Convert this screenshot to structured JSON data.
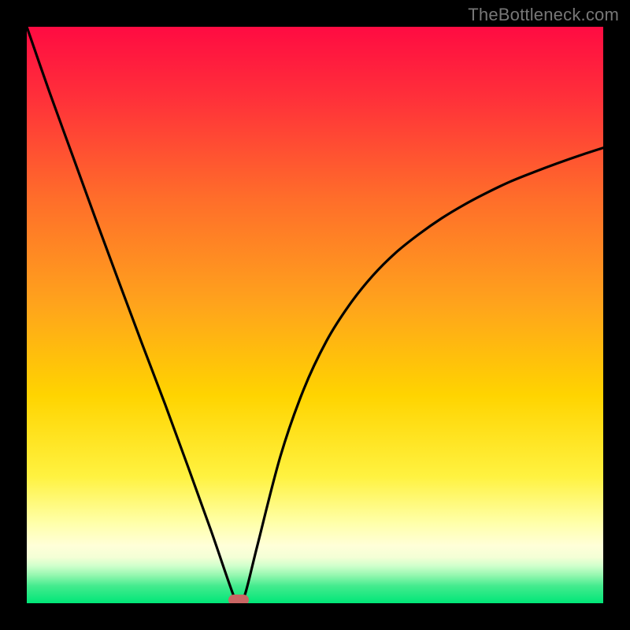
{
  "watermark": "TheBottleneck.com",
  "chart_data": {
    "type": "line",
    "title": "",
    "xlabel": "",
    "ylabel": "",
    "xlim": [
      0,
      1
    ],
    "ylim": [
      0,
      1
    ],
    "x": [
      0.0,
      0.04,
      0.08,
      0.12,
      0.16,
      0.2,
      0.24,
      0.28,
      0.32,
      0.36,
      0.37,
      0.38,
      0.4,
      0.44,
      0.48,
      0.52,
      0.56,
      0.6,
      0.64,
      0.68,
      0.72,
      0.76,
      0.8,
      0.84,
      0.88,
      0.92,
      0.96,
      1.0
    ],
    "values": [
      1.0,
      0.885,
      0.775,
      0.665,
      0.557,
      0.45,
      0.345,
      0.236,
      0.125,
      0.01,
      0.0,
      0.02,
      0.1,
      0.255,
      0.37,
      0.455,
      0.518,
      0.568,
      0.608,
      0.64,
      0.668,
      0.692,
      0.713,
      0.732,
      0.748,
      0.763,
      0.777,
      0.79
    ],
    "legend": {
      "entries": []
    },
    "grid": false,
    "marker_x": 0.368,
    "marker_y": 0.0,
    "annotations": [],
    "background_colors": {
      "top": "#ff0b42",
      "middle": "#ffd500",
      "bottom_light": "#ffffd0",
      "green": "#00e678"
    }
  }
}
